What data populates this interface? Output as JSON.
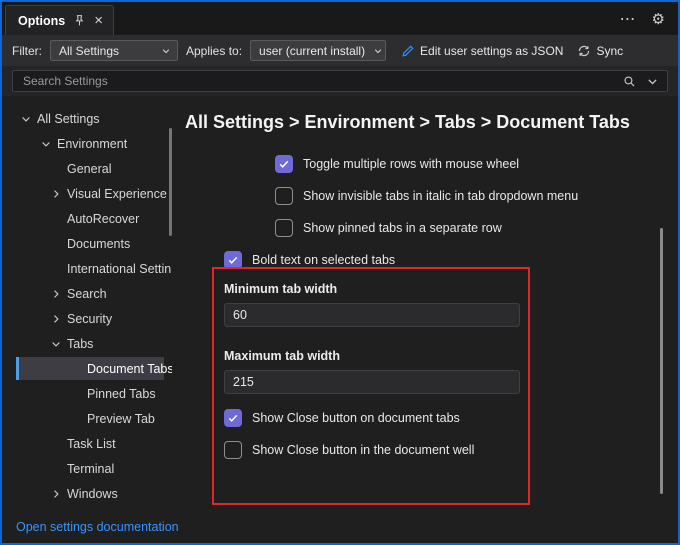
{
  "window": {
    "tab_label": "Options",
    "ellipsis_glyph": "⋯",
    "gear_glyph": "⚙",
    "close_glyph": "×"
  },
  "toolbar": {
    "filter_label": "Filter:",
    "filter_value": "All Settings",
    "applies_to_label": "Applies to:",
    "applies_to_value": "user (current install)",
    "edit_json_label": "Edit user settings as JSON",
    "sync_label": "Sync"
  },
  "search": {
    "placeholder": "Search Settings"
  },
  "sidebar": {
    "items": [
      {
        "label": "All Settings"
      },
      {
        "label": "Environment"
      },
      {
        "label": "General"
      },
      {
        "label": "Visual Experience"
      },
      {
        "label": "AutoRecover"
      },
      {
        "label": "Documents"
      },
      {
        "label": "International Settin"
      },
      {
        "label": "Search"
      },
      {
        "label": "Security"
      },
      {
        "label": "Tabs"
      },
      {
        "label": "Document Tabs"
      },
      {
        "label": "Pinned Tabs"
      },
      {
        "label": "Preview Tab"
      },
      {
        "label": "Task List"
      },
      {
        "label": "Terminal"
      },
      {
        "label": "Windows"
      }
    ]
  },
  "main": {
    "breadcrumb": "All Settings > Environment > Tabs > Document Tabs",
    "toggles": [
      {
        "label": "Toggle multiple rows with mouse wheel",
        "checked": true
      },
      {
        "label": "Show invisible tabs in italic in tab dropdown menu",
        "checked": false
      },
      {
        "label": "Show pinned tabs in a separate row",
        "checked": false
      },
      {
        "label": "Bold text on selected tabs",
        "checked": true
      },
      {
        "label": "Show Close button on document tabs",
        "checked": true
      },
      {
        "label": "Show Close button in the document well",
        "checked": false
      }
    ],
    "min_tab_width": {
      "label": "Minimum tab width",
      "value": "60"
    },
    "max_tab_width": {
      "label": "Maximum tab width",
      "value": "215"
    }
  },
  "footer": {
    "doc_link": "Open settings documentation"
  },
  "colors": {
    "accent": "#6e6ad8",
    "annotation": "#e3242b",
    "link": "#3794ff",
    "selection": "#4b9fe8"
  }
}
